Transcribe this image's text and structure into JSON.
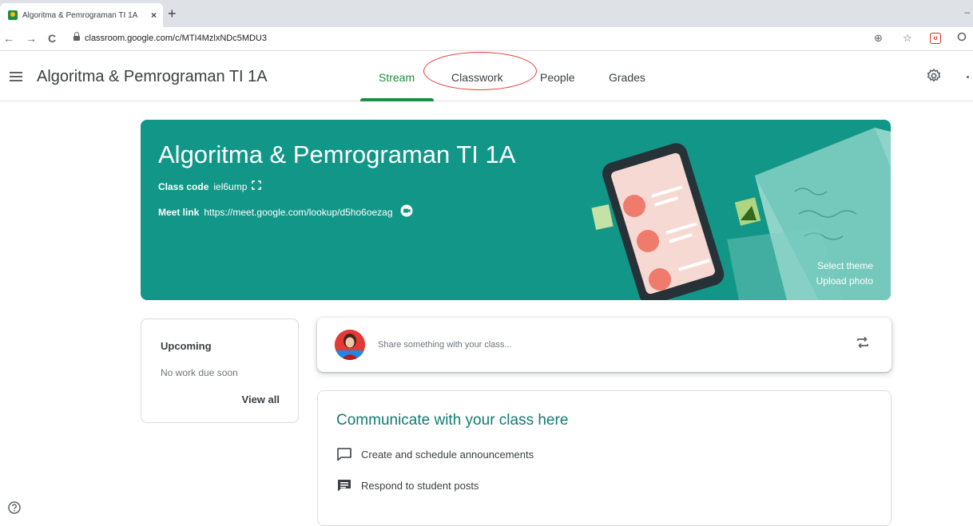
{
  "browser": {
    "tab_title": "Algoritma & Pemrograman TI 1A",
    "tab_close": "×",
    "new_tab": "+",
    "minimize": "–",
    "url": "classroom.google.com/c/MTI4MzlxNDc5MDU3",
    "nav_back": "←",
    "nav_forward": "→",
    "nav_reload": "C",
    "zoom_icon": "⊕",
    "star_icon": "☆",
    "extension_label": "ʊ"
  },
  "header": {
    "class_title": "Algoritma & Pemrograman TI 1A",
    "tabs": [
      {
        "label": "Stream",
        "active": true
      },
      {
        "label": "Classwork",
        "active": false
      },
      {
        "label": "People",
        "active": false
      },
      {
        "label": "Grades",
        "active": false
      }
    ]
  },
  "banner": {
    "title": "Algoritma & Pemrograman TI 1A",
    "class_code_label": "Class code",
    "class_code": "iel6ump",
    "meet_label": "Meet link",
    "meet_url": "https://meet.google.com/lookup/d5ho6oezag",
    "select_theme": "Select theme",
    "upload_photo": "Upload photo",
    "bg_color": "#129688"
  },
  "upcoming": {
    "title": "Upcoming",
    "subtitle": "No work due soon",
    "view_all": "View all"
  },
  "share": {
    "placeholder": "Share something with your class..."
  },
  "communicate": {
    "title": "Communicate with your class here",
    "items": [
      {
        "label": "Create and schedule announcements",
        "icon": "announcement-icon"
      },
      {
        "label": "Respond to student posts",
        "icon": "comment-icon"
      }
    ]
  },
  "colors": {
    "accent": "#1e8e3e",
    "annotation": "#e53935"
  }
}
